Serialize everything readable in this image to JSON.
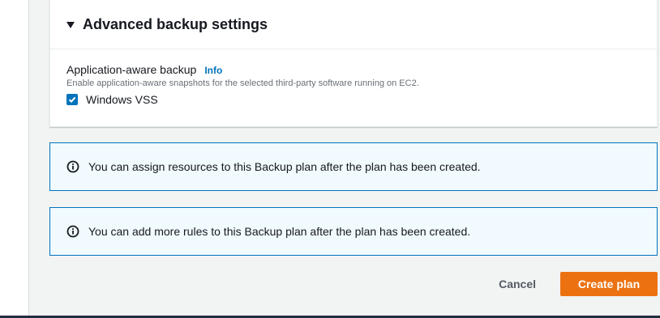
{
  "advanced_settings": {
    "title": "Advanced backup settings",
    "expanded": true,
    "field_label": "Application-aware backup",
    "info_label": "Info",
    "description": "Enable application-aware snapshots for the selected third-party software running on EC2.",
    "checkbox_label": "Windows VSS",
    "checkbox_checked": true
  },
  "alerts": [
    {
      "icon": "info-icon",
      "text": "You can assign resources to this Backup plan after the plan has been created."
    },
    {
      "icon": "info-icon",
      "text": "You can add more rules to this Backup plan after the plan has been created."
    }
  ],
  "actions": {
    "cancel_label": "Cancel",
    "create_label": "Create plan"
  },
  "colors": {
    "primary": "#ec7211",
    "link": "#0073bb",
    "alert_bg": "#f1faff",
    "alert_border": "#0073bb"
  }
}
